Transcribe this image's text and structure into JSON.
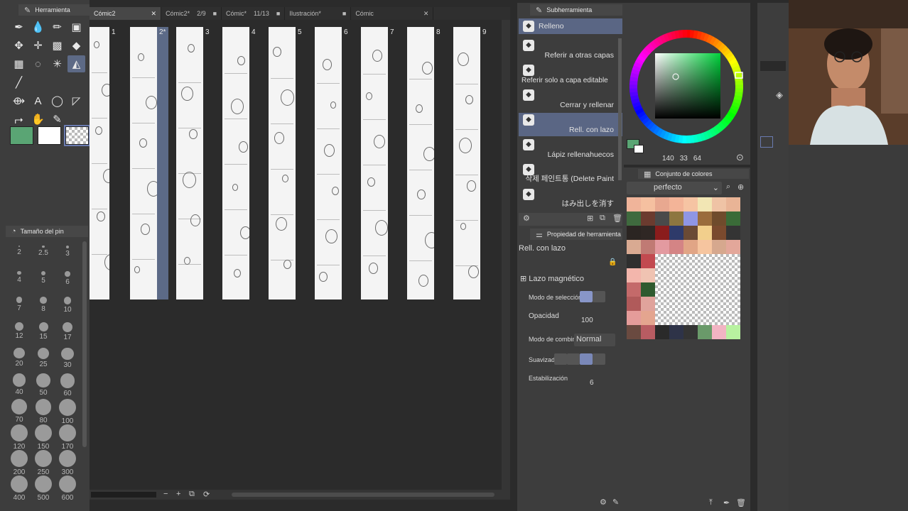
{
  "tool_panel": {
    "title": "Herramienta",
    "tools": [
      "pen-icon",
      "ink-drop-icon",
      "pencil-icon",
      "image-icon",
      "figure-icon",
      "move-icon",
      "rectangle-icon",
      "eraser-icon",
      "grid-icon",
      "lasso-icon",
      "sparkle-icon",
      "fill-icon",
      "line-icon",
      "blank",
      "blank",
      "blank",
      "transform-icon",
      "text-icon",
      "speech-balloon-icon",
      "ruler-icon",
      "select-arrow-icon",
      "hand-icon",
      "eyedropper-icon",
      "blank"
    ],
    "colors": {
      "main": "#5aa574",
      "sub": "#ffffff"
    },
    "brush_size_title": "Tamaño del pin",
    "brush_sizes": [
      "2",
      "2.5",
      "3",
      "4",
      "5",
      "6",
      "7",
      "8",
      "10",
      "12",
      "15",
      "17",
      "20",
      "25",
      "30",
      "40",
      "50",
      "60",
      "70",
      "80",
      "100",
      "120",
      "150",
      "170",
      "200",
      "250",
      "300",
      "400",
      "500",
      "600"
    ]
  },
  "tabs": [
    {
      "label": "Cómic2",
      "count": ""
    },
    {
      "label": "Cómic2*",
      "count": "2/9"
    },
    {
      "label": "Cómic*",
      "count": "11/13"
    },
    {
      "label": "Ilustración*",
      "count": ""
    },
    {
      "label": "Cómic",
      "count": ""
    }
  ],
  "pages": [
    "1",
    "2*",
    "3",
    "4",
    "5",
    "6",
    "7",
    "8",
    "9"
  ],
  "subtool": {
    "title": "Subherramienta",
    "header": "Relleno",
    "items": [
      "Referir a otras capas",
      "Referir solo a capa editable",
      "Cerrar y rellenar",
      "Rell. con lazo",
      "Lápiz rellenahuecos",
      "삭제 페인트통 (Delete Paint",
      "はみ出しを消す"
    ]
  },
  "tool_property": {
    "title": "Propiedad de herramienta",
    "tool_name": "Rell. con lazo",
    "mode": "Lazo magnético",
    "select_mode_label": "Modo de selección",
    "opacity_label": "Opacidad",
    "opacity_value": "100",
    "blend_label": "Modo de combinación",
    "blend_value": "Normal",
    "smooth_label": "Suavizado",
    "stabilization_label": "Estabilización",
    "stabilization_value": "6"
  },
  "color": {
    "h": "140",
    "s": "33",
    "v": "64"
  },
  "palette": {
    "title": "Conjunto de colores",
    "set_name": "perfecto",
    "colors": [
      "#f0b49a",
      "#f5c0a0",
      "#e8a890",
      "#f3b498",
      "#f6c4a3",
      "#f2e6b4",
      "#efc3a5",
      "#e9b496",
      "#3f6a3e",
      "#6b3b2f",
      "#4a4a4a",
      "#8d7640",
      "#8f96e5",
      "#9a6c3c",
      "#6f4b2c",
      "#3a6b38",
      "#2b2522",
      "#2f2724",
      "#8a1c1c",
      "#2e3a6a",
      "#6a4a35",
      "#f2cf8c",
      "#7a4a2e",
      "#343434",
      "#d9aa92",
      "#c07a74",
      "#e39aa0",
      "#d48485",
      "#e1a586",
      "#f6c59f",
      "#d6a88e",
      "#e3a79a",
      "#2f2f2f",
      "#c24a50",
      "#d68a91",
      "#f2f2f2",
      "",
      "",
      "",
      "",
      "#f3b6ac",
      "#f0c3b2",
      "",
      "",
      "",
      "",
      "",
      "",
      "#c46a6a",
      "#2f5a2f",
      "",
      "",
      "",
      "",
      "",
      "",
      "#b05a5a",
      "#e0a39c",
      "",
      "",
      "",
      "",
      "",
      "",
      "#e59c9a",
      "#e4a58f",
      "",
      "",
      "",
      "",
      "",
      "",
      "#6a4a40",
      "#b85c62",
      "#2a2a2a",
      "#2e3348",
      "#343434",
      "#6a9a6a",
      "#f2b4c3",
      "#b8f2a0"
    ]
  }
}
